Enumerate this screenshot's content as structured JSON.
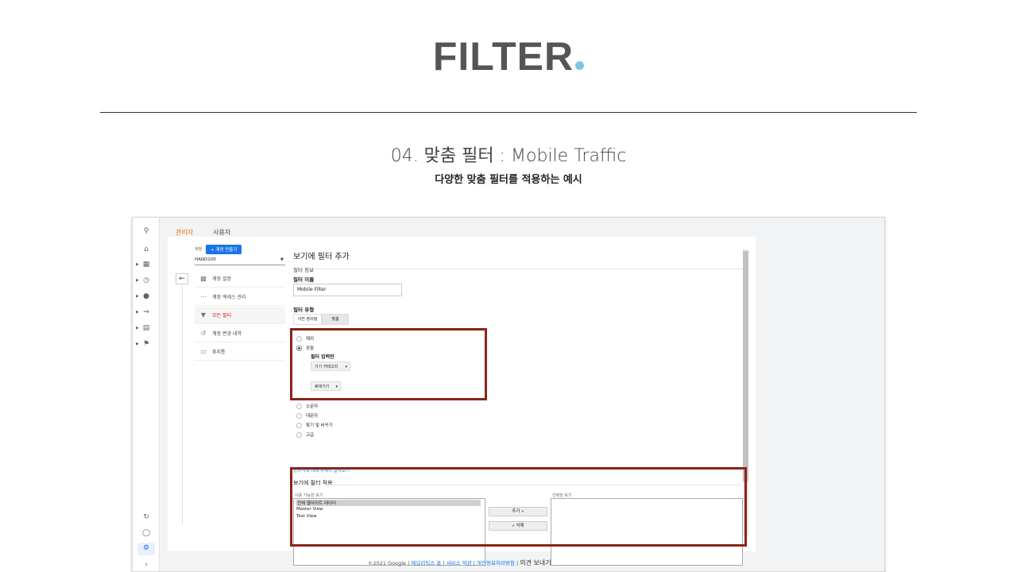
{
  "slide": {
    "title": "FILTER",
    "heading": "04. 맞춤 필터 : Mobile Traffic",
    "subheading": "다양한 맞춤 필터를 적용하는 예시",
    "accent_dot_color": "#7fc8dc",
    "highlight_color": "#8b2418"
  },
  "rail": {
    "items": [
      "search-icon",
      "home-icon",
      "dashboard-icon",
      "clock-icon",
      "person-icon",
      "acquisition-icon",
      "behavior-icon",
      "flag-icon",
      "attribution-icon",
      "lightbulb-icon",
      "gear-icon",
      "expand-icon"
    ]
  },
  "tabs": {
    "admin": "관리자",
    "user": "사용자"
  },
  "account": {
    "label": "계정",
    "create_button": "+ 계정 만들기",
    "name": "HAND100"
  },
  "menu": {
    "items": [
      {
        "label": "계정 설정",
        "icon": "building-icon"
      },
      {
        "label": "계정 액세스 관리",
        "icon": "people-icon"
      },
      {
        "label": "모든 필터",
        "icon": "filter-icon"
      },
      {
        "label": "계정 변경 내역",
        "icon": "history-icon"
      },
      {
        "label": "휴지통",
        "icon": "trash-icon"
      }
    ]
  },
  "form": {
    "title": "보기에 필터 추가",
    "section_info": "필터 정보",
    "name_label": "필터 이름",
    "name_value": "Mobile Filter",
    "type_label": "필터 유형",
    "type_predefined": "사전 정의됨",
    "type_custom": "맞춤",
    "opt_exclude": "제외",
    "opt_include": "포함",
    "field_label": "필터 입력란",
    "field_select": "기기 카테고리",
    "pattern_select": "휴대기기",
    "opt_lowercase": "소문자",
    "opt_uppercase": "대문자",
    "opt_search_replace": "찾기 및 바꾸기",
    "opt_advanced": "고급",
    "regex_link": "정규식에 대해 자세히 알아보기",
    "apply_label": "보기에 필터 적용",
    "available_caption": "사용 가능한 보기",
    "selected_caption": "선택한 보기",
    "views": [
      "전체 웹사이트 데이터",
      "Master View",
      "Test View"
    ],
    "add_button": "추가 »",
    "remove_button": "« 삭제"
  },
  "footer": {
    "copyright": "©2021 Google",
    "home": "애널리틱스 홈",
    "terms": "서비스 약관",
    "privacy": "개인정보처리방침",
    "feedback": "의견 보내기",
    "sep": "|"
  }
}
